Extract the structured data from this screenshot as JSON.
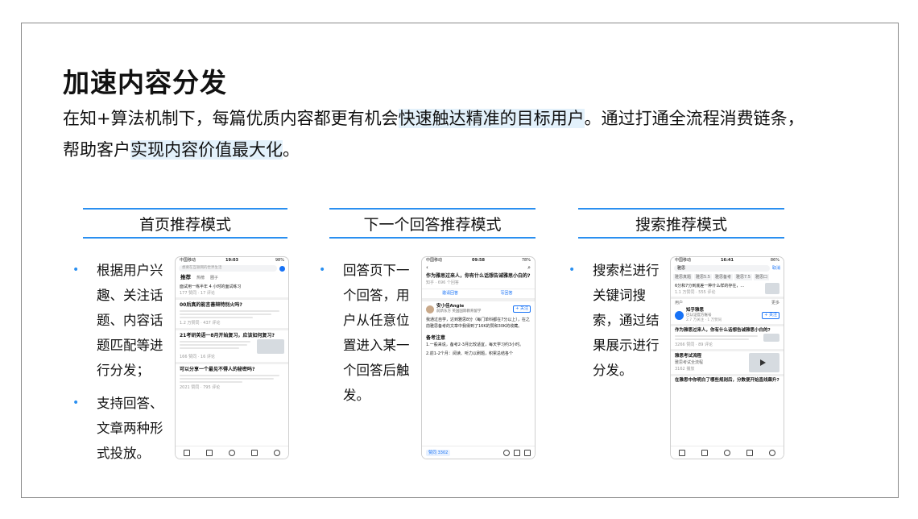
{
  "title": "加速内容分发",
  "intro": {
    "p1": "在知+算法机制下，每篇优质内容都更有机会",
    "p1_hl": "快速触达精准的目标用户",
    "p2": "。通过打通全流程消费链条，帮助客户",
    "p2_hl": "实现内容价值最大化",
    "p3": "。"
  },
  "columns": [
    {
      "heading": "首页推荐模式",
      "bullets": [
        "根据用户兴趣、关注话题、内容话题匹配等进行分发；",
        "支持回答、文章两种形式投放。"
      ]
    },
    {
      "heading": "下一个回答推荐模式",
      "bullets": [
        "回答页下一个回答，用户从任意位置进入某一个回答后触发。"
      ]
    },
    {
      "heading": "搜索推荐模式",
      "bullets": [
        "搜索栏进行关键词搜索，通过结果展示进行分发。"
      ]
    }
  ],
  "phone1": {
    "status_left": "中国移动",
    "status_time": "19:03",
    "status_right": "98%",
    "search_placeholder": "想要在互联网的世界生活",
    "tabs": [
      "推荐",
      "热榜",
      "圈子"
    ],
    "items": [
      {
        "title": "面试用一练半年 4 小时的面试练习",
        "meta": "177 赞同 · 17 评论"
      },
      {
        "title": "00后真的能言善辩特别火吗?",
        "meta": "1.2 万赞同 · 437 评论"
      },
      {
        "title": "21考研英语一8月开始复习，应该如何复习?",
        "meta": "166 赞同 · 16 评论"
      },
      {
        "title": "可以分享一个最见不得人的秘密吗?",
        "meta": "2021 赞同 · 795 评论"
      }
    ]
  },
  "phone2": {
    "status_left": "中国移动",
    "status_time": "09:58",
    "status_right": "78%",
    "question": "作为雅思过来人，你有什么话想告诫雅思小白的?",
    "question_meta": "知乎 · 696 个回答",
    "invite": "邀请回答",
    "write": "写回答",
    "author": "安小佳Angie",
    "author_sub": "前新东方 英国国际教育留学",
    "follow": "+ 关注",
    "body_1": "我通过自学，达到雅思8分（每门单科都在7分以上），在之前雅思备考的文章中我得到了16K的赞和30K的收藏。",
    "section": "备考注意",
    "body_2": "1.一般来说，备考2-3月比较适宜，每天学习约3小时。",
    "body_3": "2.前1-2个月：阅读、听力以刷题，积累总结各个",
    "vote": "赞同 3302"
  },
  "phone3": {
    "status_left": "中国移动",
    "status_time": "16:41",
    "status_right": "86%",
    "search_value": "雅思",
    "cancel": "取消",
    "chips": [
      "雅思真题",
      "雅思5.5",
      "雅思备考",
      "雅思7.5",
      "雅思口"
    ],
    "snippet": "6分和7分到底差一种什么样的存在，...",
    "snippet_meta": "1.1 万赞同 · 555 评论",
    "users_label": "用户",
    "more": "更多",
    "user_name": "知乎雅思",
    "user_sub": "已认证官方账号",
    "user_meta": "2.7 万关注 · 1 万赞同",
    "follow": "+ 关注",
    "result_title": "作为雅思过来人，你有什么话想告诫雅思小白的?",
    "result_meta": "3266 赞同 · 89 评论",
    "course_title": "雅思考试流程",
    "course_sub": "雅思考试全流程",
    "course_meta": "3162 播放",
    "last_title": "在雅思中你明白了哪些规则后，分数便开始直线飙升?"
  }
}
